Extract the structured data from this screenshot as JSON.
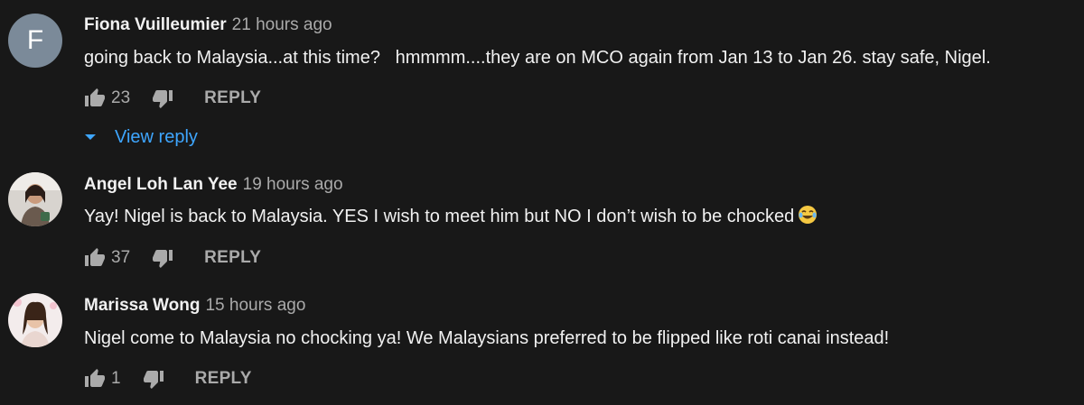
{
  "comments": [
    {
      "author": "Fiona Vuilleumier",
      "time": "21 hours ago",
      "avatar_letter": "F",
      "text": "going back to Malaysia...at this time?   hmmmm....they are on MCO again from Jan 13 to Jan 26. stay safe, Nigel.",
      "likes": "23",
      "reply_label": "REPLY",
      "view_reply_label": "View reply"
    },
    {
      "author": "Angel Loh Lan Yee",
      "time": "19 hours ago",
      "text": "Yay! Nigel is back to Malaysia. YES I wish to meet him but NO I don’t wish to be chocked",
      "emoji": "tears-of-joy-emoji",
      "likes": "37",
      "reply_label": "REPLY"
    },
    {
      "author": "Marissa Wong",
      "time": "15 hours ago",
      "text": "Nigel come to Malaysia no chocking ya! We Malaysians preferred to be flipped like roti canai instead!",
      "likes": "1",
      "reply_label": "REPLY"
    }
  ],
  "colors": {
    "background": "#181818",
    "text_primary": "#f1f1f1",
    "text_secondary": "#aaaaaa",
    "link_blue": "#3ea6ff",
    "avatar_f_bg": "#7b8a99"
  },
  "icons": [
    "thumb-up-icon",
    "thumb-down-icon",
    "chevron-down-icon"
  ]
}
